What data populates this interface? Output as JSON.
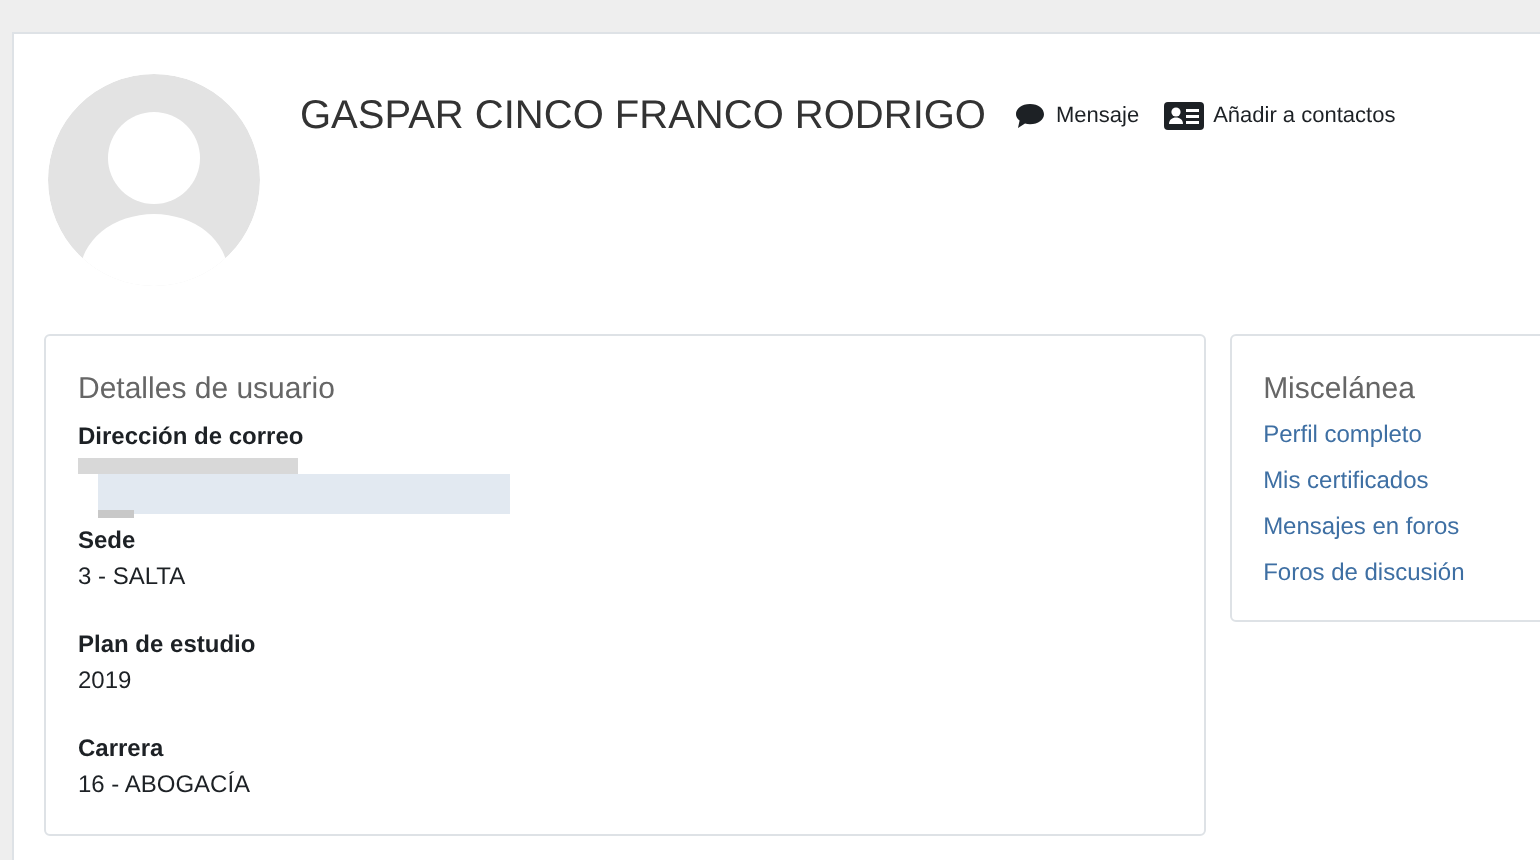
{
  "profile": {
    "name": "GASPAR CINCO FRANCO RODRIGO",
    "actions": [
      {
        "kind": "message",
        "label": "Mensaje"
      },
      {
        "kind": "contact",
        "label": "Añadir a contactos"
      }
    ]
  },
  "details": {
    "title": "Detalles de usuario",
    "fields": [
      {
        "kind": "blurred",
        "label": "Dirección de correo"
      },
      {
        "kind": "text",
        "label": "Sede",
        "value": "3 - SALTA"
      },
      {
        "kind": "text",
        "label": "Plan de estudio",
        "value": "2019"
      },
      {
        "kind": "text",
        "label": "Carrera",
        "value": "16 - ABOGACÍA"
      }
    ]
  },
  "misc": {
    "title": "Miscelánea",
    "links": [
      "Perfil completo",
      "Mis certificados",
      "Mensajes en foros",
      "Foros de discusión"
    ]
  }
}
